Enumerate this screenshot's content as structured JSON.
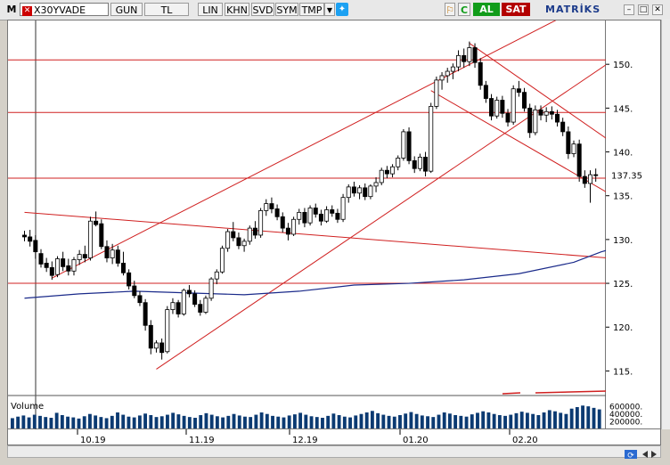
{
  "window": {
    "app_letter": "M",
    "symbol": "X30YVADE",
    "buttons": [
      "GUN",
      "TL",
      "LIN",
      "KHN",
      "SVD",
      "SYM",
      "TMP"
    ],
    "buy_label": "AL",
    "sell_label": "SAT",
    "brand": "MATRİKS"
  },
  "chart_data": [
    {
      "type": "candlestick",
      "title": "",
      "x_tick_labels": [
        "10.19",
        "11.19",
        "12.19",
        "01.20",
        "02.20"
      ],
      "y_tick_labels": [
        "115.",
        "120.",
        "125.",
        "130.",
        "135.",
        "140.",
        "145.",
        "150."
      ],
      "ylim": [
        112.5,
        155
      ],
      "last_price_label": "137.35",
      "horizontal_levels": [
        125,
        137,
        144.5,
        150.5
      ],
      "moving_average": [
        [
          0,
          123.3
        ],
        [
          20,
          123.8
        ],
        [
          40,
          124.1
        ],
        [
          60,
          123.9
        ],
        [
          80,
          123.7
        ],
        [
          100,
          124.1
        ],
        [
          120,
          124.8
        ],
        [
          140,
          125.0
        ],
        [
          160,
          125.4
        ],
        [
          180,
          126.1
        ],
        [
          200,
          127.4
        ],
        [
          210,
          128.6
        ],
        [
          230,
          130.3
        ],
        [
          250,
          131.8
        ],
        [
          270,
          132.6
        ],
        [
          280,
          133.1
        ],
        [
          300,
          134.0
        ],
        [
          315,
          134.7
        ],
        [
          323,
          134.9
        ],
        [
          328,
          135.0
        ],
        [
          329,
          135.0
        ]
      ],
      "candles": [
        [
          0,
          130.5,
          131.0,
          129.8,
          130.3
        ],
        [
          2,
          130.3,
          131.1,
          129.2,
          129.8
        ],
        [
          4,
          129.9,
          130.5,
          127.8,
          128.6
        ],
        [
          6,
          128.4,
          128.9,
          126.8,
          127.2
        ],
        [
          8,
          127.3,
          127.9,
          126.3,
          126.8
        ],
        [
          10,
          126.8,
          127.5,
          125.4,
          125.9
        ],
        [
          12,
          126.0,
          128.1,
          125.7,
          127.8
        ],
        [
          14,
          127.8,
          128.6,
          126.4,
          126.9
        ],
        [
          16,
          127.0,
          127.8,
          125.9,
          126.4
        ],
        [
          18,
          126.4,
          128.0,
          125.9,
          127.7
        ],
        [
          20,
          127.7,
          128.8,
          127.1,
          128.3
        ],
        [
          22,
          128.3,
          129.3,
          127.4,
          127.9
        ],
        [
          24,
          127.9,
          132.6,
          127.6,
          132.1
        ],
        [
          26,
          132.1,
          133.2,
          131.5,
          131.7
        ],
        [
          28,
          131.8,
          132.3,
          128.9,
          129.2
        ],
        [
          30,
          129.2,
          129.9,
          127.4,
          127.9
        ],
        [
          32,
          127.9,
          129.5,
          127.2,
          128.8
        ],
        [
          34,
          128.8,
          129.3,
          126.9,
          127.3
        ],
        [
          36,
          127.3,
          128.6,
          125.9,
          126.2
        ],
        [
          38,
          126.2,
          126.6,
          124.3,
          124.7
        ],
        [
          40,
          124.7,
          125.3,
          123.3,
          123.6
        ],
        [
          42,
          123.6,
          124.1,
          122.4,
          122.8
        ],
        [
          44,
          122.8,
          123.2,
          119.6,
          120.2
        ],
        [
          46,
          120.2,
          120.8,
          116.9,
          117.6
        ],
        [
          48,
          117.6,
          118.5,
          117.1,
          118.2
        ],
        [
          50,
          118.2,
          118.7,
          116.3,
          117.1
        ],
        [
          52,
          117.2,
          122.4,
          117.0,
          122.0
        ],
        [
          54,
          122.0,
          123.3,
          121.5,
          122.8
        ],
        [
          56,
          122.8,
          123.1,
          121.1,
          121.5
        ],
        [
          58,
          121.5,
          124.4,
          121.3,
          124.2
        ],
        [
          60,
          124.2,
          124.8,
          123.4,
          123.8
        ],
        [
          62,
          123.8,
          124.2,
          122.3,
          122.6
        ],
        [
          64,
          122.6,
          123.1,
          121.3,
          121.7
        ],
        [
          66,
          121.7,
          123.6,
          121.5,
          123.3
        ],
        [
          68,
          123.3,
          125.7,
          123.0,
          125.5
        ],
        [
          70,
          125.5,
          126.6,
          124.9,
          126.3
        ],
        [
          72,
          126.3,
          129.3,
          126.1,
          129.0
        ],
        [
          74,
          129.0,
          131.2,
          128.6,
          130.9
        ],
        [
          76,
          130.9,
          132.0,
          129.8,
          130.2
        ],
        [
          78,
          130.2,
          130.8,
          128.9,
          129.3
        ],
        [
          80,
          129.3,
          130.1,
          128.6,
          129.8
        ],
        [
          82,
          129.8,
          131.6,
          129.4,
          131.3
        ],
        [
          84,
          131.3,
          132.1,
          130.1,
          130.5
        ],
        [
          86,
          130.5,
          133.6,
          130.2,
          133.3
        ],
        [
          88,
          133.3,
          134.6,
          132.7,
          134.1
        ],
        [
          90,
          134.1,
          134.8,
          133.0,
          133.5
        ],
        [
          92,
          133.5,
          134.0,
          132.2,
          132.6
        ],
        [
          94,
          132.6,
          133.1,
          130.8,
          131.3
        ],
        [
          96,
          131.3,
          131.9,
          129.9,
          130.6
        ],
        [
          98,
          130.6,
          132.6,
          130.4,
          132.3
        ],
        [
          100,
          132.3,
          133.5,
          131.7,
          133.1
        ],
        [
          102,
          133.1,
          133.6,
          131.4,
          131.9
        ],
        [
          104,
          131.9,
          133.9,
          131.6,
          133.6
        ],
        [
          106,
          133.6,
          134.1,
          132.5,
          132.9
        ],
        [
          108,
          132.9,
          133.4,
          131.6,
          132.1
        ],
        [
          110,
          132.1,
          133.8,
          131.9,
          133.4
        ],
        [
          112,
          133.4,
          133.9,
          132.6,
          133.0
        ],
        [
          114,
          133.0,
          133.5,
          131.9,
          132.3
        ],
        [
          116,
          132.3,
          135.2,
          132.0,
          134.8
        ],
        [
          118,
          134.8,
          136.3,
          134.2,
          136.0
        ],
        [
          120,
          136.0,
          136.6,
          134.9,
          135.3
        ],
        [
          122,
          135.3,
          136.2,
          134.6,
          135.9
        ],
        [
          124,
          135.9,
          136.4,
          134.5,
          134.9
        ],
        [
          126,
          134.9,
          136.3,
          134.6,
          136.1
        ],
        [
          128,
          136.1,
          137.1,
          135.4,
          136.5
        ],
        [
          130,
          136.5,
          138.2,
          136.2,
          137.9
        ],
        [
          132,
          137.9,
          138.4,
          137.0,
          137.5
        ],
        [
          134,
          137.5,
          138.6,
          137.1,
          138.3
        ],
        [
          136,
          138.3,
          139.6,
          137.9,
          139.3
        ],
        [
          138,
          139.3,
          142.6,
          139.0,
          142.3
        ],
        [
          140,
          142.3,
          142.8,
          138.6,
          139.0
        ],
        [
          142,
          139.0,
          139.5,
          137.6,
          138.1
        ],
        [
          144,
          138.1,
          139.8,
          137.8,
          139.4
        ],
        [
          146,
          139.4,
          140.0,
          137.2,
          137.8
        ],
        [
          148,
          137.8,
          145.6,
          137.6,
          145.2
        ],
        [
          150,
          145.2,
          148.6,
          144.9,
          148.2
        ],
        [
          152,
          148.2,
          149.1,
          147.1,
          148.7
        ],
        [
          154,
          148.7,
          149.6,
          147.9,
          149.2
        ],
        [
          156,
          149.2,
          150.1,
          148.3,
          149.7
        ],
        [
          158,
          149.7,
          151.6,
          149.2,
          151.0
        ],
        [
          160,
          151.0,
          151.8,
          149.6,
          150.3
        ],
        [
          162,
          150.3,
          152.6,
          149.8,
          151.9
        ],
        [
          164,
          151.9,
          152.4,
          149.6,
          150.2
        ],
        [
          166,
          150.2,
          150.7,
          147.1,
          147.6
        ],
        [
          168,
          147.6,
          148.1,
          145.6,
          146.1
        ],
        [
          170,
          146.1,
          146.6,
          143.6,
          144.1
        ],
        [
          172,
          144.1,
          146.3,
          143.8,
          145.9
        ],
        [
          174,
          145.9,
          146.4,
          143.9,
          144.4
        ],
        [
          176,
          144.4,
          144.9,
          142.9,
          143.4
        ],
        [
          178,
          143.4,
          147.6,
          143.1,
          147.2
        ],
        [
          180,
          147.2,
          148.1,
          146.3,
          146.8
        ],
        [
          182,
          146.8,
          147.3,
          144.6,
          145.0
        ],
        [
          184,
          145.0,
          145.5,
          141.6,
          142.2
        ],
        [
          186,
          142.2,
          145.3,
          141.9,
          144.8
        ],
        [
          188,
          144.8,
          145.3,
          143.6,
          144.2
        ],
        [
          190,
          144.2,
          145.1,
          143.4,
          144.6
        ],
        [
          192,
          144.6,
          145.2,
          143.7,
          144.3
        ],
        [
          194,
          144.3,
          144.8,
          142.9,
          143.4
        ],
        [
          196,
          143.4,
          143.9,
          141.8,
          142.3
        ],
        [
          198,
          142.3,
          142.9,
          139.2,
          139.8
        ],
        [
          200,
          139.8,
          141.3,
          139.4,
          140.9
        ],
        [
          202,
          140.9,
          141.4,
          136.6,
          137.2
        ],
        [
          204,
          137.2,
          137.9,
          135.9,
          136.4
        ],
        [
          206,
          136.4,
          137.9,
          134.2,
          137.4
        ],
        [
          208,
          137.4,
          138.1,
          136.6,
          137.35
        ]
      ],
      "channel_lines": [
        {
          "from": [
            10,
            125.6
          ],
          "to": [
            212,
            158.0
          ]
        },
        {
          "from": [
            48,
            115.2
          ],
          "to": [
            212,
            150.0
          ]
        },
        {
          "from": [
            162,
            152.4
          ],
          "to": [
            212,
            141.5
          ]
        },
        {
          "from": [
            148,
            147.0
          ],
          "to": [
            212,
            135.4
          ]
        },
        {
          "from": [
            0,
            133.1
          ],
          "to": [
            212,
            127.9
          ]
        }
      ],
      "x_range": [
        -6,
        212
      ]
    },
    {
      "type": "bar",
      "title": "Volume",
      "y_tick_labels": [
        "600000.",
        "400000.",
        "200000."
      ],
      "ylim": [
        0,
        700000
      ],
      "values": [
        270000,
        310000,
        340000,
        290000,
        360000,
        330000,
        300000,
        280000,
        410000,
        350000,
        310000,
        290000,
        260000,
        320000,
        380000,
        340000,
        300000,
        270000,
        330000,
        420000,
        360000,
        310000,
        290000,
        340000,
        390000,
        350000,
        300000,
        320000,
        360000,
        410000,
        370000,
        330000,
        300000,
        280000,
        350000,
        400000,
        360000,
        320000,
        290000,
        330000,
        380000,
        340000,
        310000,
        300000,
        360000,
        420000,
        380000,
        330000,
        310000,
        290000,
        340000,
        370000,
        410000,
        360000,
        320000,
        300000,
        280000,
        330000,
        390000,
        350000,
        310000,
        290000,
        340000,
        380000,
        420000,
        460000,
        400000,
        360000,
        330000,
        310000,
        350000,
        390000,
        430000,
        380000,
        340000,
        320000,
        300000,
        360000,
        420000,
        390000,
        350000,
        330000,
        310000,
        370000,
        410000,
        450000,
        420000,
        380000,
        350000,
        330000,
        360000,
        400000,
        440000,
        410000,
        380000,
        350000,
        420000,
        480000,
        450000,
        410000,
        380000,
        520000,
        560000,
        600000,
        580000,
        540000,
        500000
      ]
    }
  ]
}
